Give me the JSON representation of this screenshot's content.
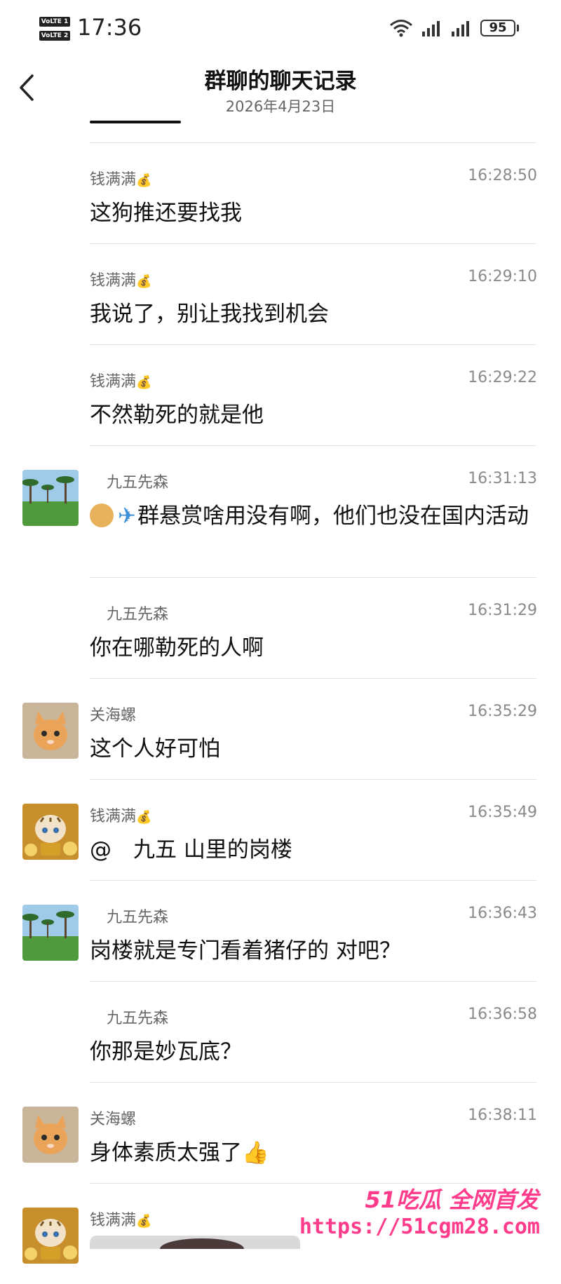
{
  "status_bar": {
    "volte1": "VoLTE 1",
    "volte2": "VoLTE 2",
    "time": "17:36",
    "battery": "95"
  },
  "header": {
    "title": "群聊的聊天记录",
    "subtitle": "2026年4月23日"
  },
  "messages": [
    {
      "sender": "钱满满",
      "badge": "💰",
      "time": "16:28:50",
      "text": "这狗推还要找我",
      "avatar": "none"
    },
    {
      "sender": "钱满满",
      "badge": "💰",
      "time": "16:29:10",
      "text": "我说了，别让我找到机会",
      "avatar": "none"
    },
    {
      "sender": "钱满满",
      "badge": "💰",
      "time": "16:29:22",
      "text": "不然勒死的就是他",
      "avatar": "none"
    },
    {
      "sender": "九五先森",
      "time": "16:31:13",
      "text_prefix_icons": [
        "doge-emoji",
        "airplane-emoji"
      ],
      "text": "群悬赏啥用没有啊，他们也没在国内活动",
      "avatar": "beach-palm-trees"
    },
    {
      "sender": "九五先森",
      "time": "16:31:29",
      "text": "你在哪勒死的人啊",
      "avatar": "none"
    },
    {
      "sender": "关海螺",
      "time": "16:35:29",
      "text": "这个人好可怕",
      "avatar": "orange-kitten"
    },
    {
      "sender": "钱满满",
      "badge": "💰",
      "time": "16:35:49",
      "text": "@　九五  山里的岗楼",
      "avatar": "golden-tiger-cub"
    },
    {
      "sender": "九五先森",
      "time": "16:36:43",
      "text": "岗楼就是专门看着猪仔的  对吧？",
      "avatar": "beach-palm-trees"
    },
    {
      "sender": "九五先森",
      "time": "16:36:58",
      "text": "你那是妙瓦底？",
      "avatar": "none"
    },
    {
      "sender": "关海螺",
      "time": "16:38:11",
      "text": "身体素质太强了",
      "suffix_icon": "thumbs-up-emoji",
      "avatar": "orange-kitten"
    },
    {
      "sender": "钱满满",
      "badge": "💰",
      "time": "",
      "text": "",
      "avatar": "golden-tiger-cub",
      "attachment": "image"
    }
  ],
  "watermark": {
    "line1": "51吃瓜 全网首发",
    "line2": "https://51cgm28.com"
  },
  "colors": {
    "accent_watermark": "#ff3c8c",
    "sender_gray": "#666666",
    "time_gray": "#8a8a8a"
  }
}
